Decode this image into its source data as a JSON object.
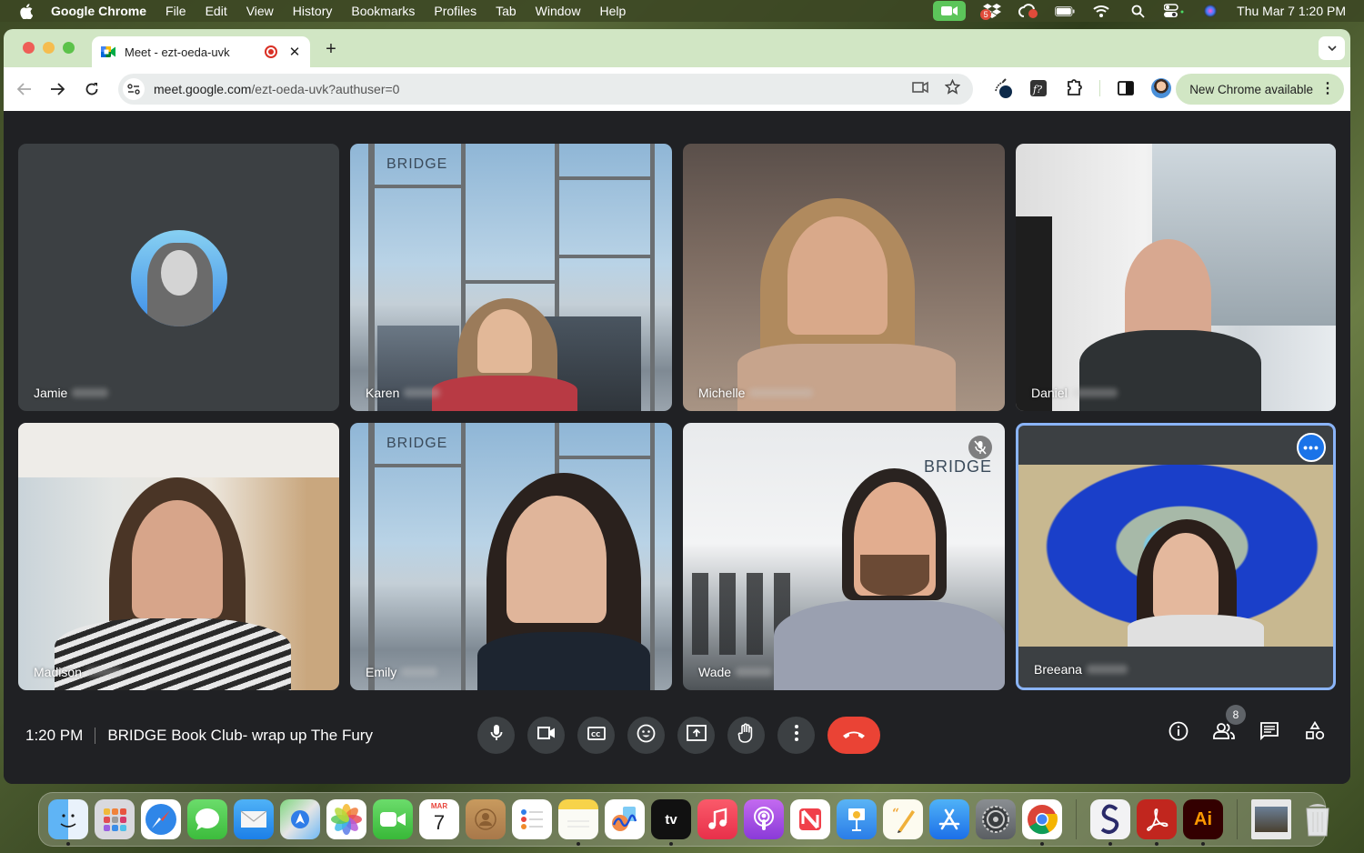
{
  "menubar": {
    "app_name": "Google Chrome",
    "items": [
      "File",
      "Edit",
      "View",
      "History",
      "Bookmarks",
      "Profiles",
      "Tab",
      "Window",
      "Help"
    ],
    "dropbox_badge": "5",
    "clock": "Thu Mar 7  1:20 PM"
  },
  "browser": {
    "tab_title": "Meet - ezt-oeda-uvk",
    "new_tab_label": "+",
    "url_host": "meet.google.com",
    "url_rest": "/ezt-oeda-uvk?authuser=0",
    "new_chrome_label": "New Chrome available",
    "colors": {
      "tabstrip": "#d1e6c4",
      "accent": "#1a73e8"
    }
  },
  "meet": {
    "participants": [
      {
        "first_name": "Jamie",
        "video": false
      },
      {
        "first_name": "Karen",
        "video": true
      },
      {
        "first_name": "Michelle",
        "video": true
      },
      {
        "first_name": "Daniel",
        "video": true
      },
      {
        "first_name": "Madison",
        "video": true
      },
      {
        "first_name": "Emily",
        "video": true
      },
      {
        "first_name": "Wade",
        "video": true,
        "muted": true
      },
      {
        "first_name": "Breeana",
        "video": true,
        "pinned_focus": true
      }
    ],
    "background_logo": "BRIDGE",
    "time": "1:20 PM",
    "meeting_title": "BRIDGE Book Club- wrap up The Fury",
    "participant_count": "8",
    "more_options_label": "•••",
    "colors": {
      "end_call": "#ea4335",
      "control_bg": "#3c4043",
      "focus_border": "#8ab4f8"
    }
  },
  "dock": {
    "calendar_month": "MAR",
    "calendar_day": "7",
    "tv_label": "tv",
    "illustrator_label": "Ai"
  }
}
